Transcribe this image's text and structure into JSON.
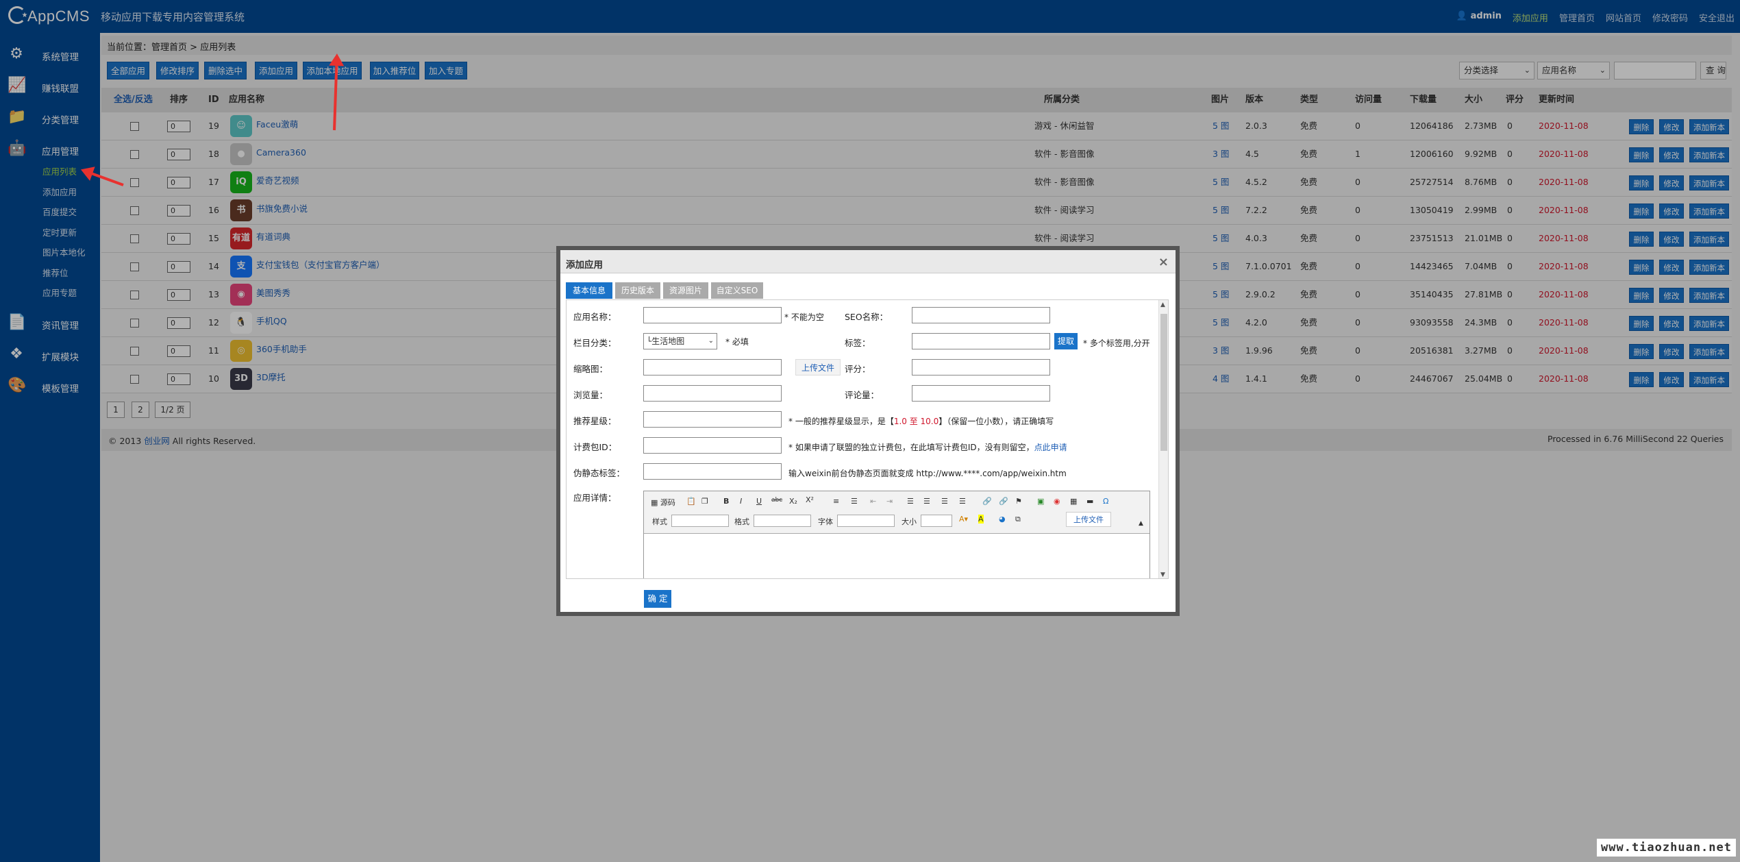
{
  "app": {
    "logo": "AppCMS",
    "tagline": "移动应用下载专用内容管理系统"
  },
  "toplinks": {
    "user": "admin",
    "add": "添加应用",
    "home": "管理首页",
    "site": "网站首页",
    "pwd": "修改密码",
    "logout": "安全退出"
  },
  "sidebar": {
    "groups": [
      "系统管理",
      "赚钱联盟",
      "分类管理",
      "应用管理",
      "资讯管理",
      "扩展模块",
      "模板管理"
    ],
    "subs": [
      "应用列表",
      "添加应用",
      "百度提交",
      "定时更新",
      "图片本地化",
      "推荐位",
      "应用专题"
    ]
  },
  "breadcrumb": {
    "prefix": "当前位置：",
    "home": "管理首页",
    "sep": ">",
    "current": "应用列表"
  },
  "toolbar": {
    "b1": "全部应用",
    "b2": "修改排序",
    "b3": "删除选中",
    "b4": "添加应用",
    "b5": "添加本地应用",
    "b6": "加入推荐位",
    "b7": "加入专题",
    "sel1": "分类选择",
    "sel2": "应用名称",
    "search": "查 询"
  },
  "table": {
    "headers": [
      "全选/反选",
      "排序",
      "ID",
      "应用名称",
      "所属分类",
      "图片",
      "版本",
      "类型",
      "访问量",
      "下载量",
      "大小",
      "评分",
      "更新时间"
    ],
    "rows": [
      {
        "order": "0",
        "id": "19",
        "name": "Faceu激萌",
        "cat": "游戏 - 休闲益智",
        "pic": "5 图",
        "ver": "2.0.3",
        "type": "免费",
        "visits": "0",
        "dl": "12064186",
        "size": "2.73MB",
        "score": "0",
        "date": "2020-11-08",
        "ic": "#5ec7c7",
        "it": "☺"
      },
      {
        "order": "0",
        "id": "18",
        "name": "Camera360",
        "cat": "软件 - 影音图像",
        "pic": "3 图",
        "ver": "4.5",
        "type": "免费",
        "visits": "1",
        "dl": "12006160",
        "size": "9.92MB",
        "score": "0",
        "date": "2020-11-08",
        "ic": "#c8c8c8",
        "it": "●"
      },
      {
        "order": "0",
        "id": "17",
        "name": "爱奇艺视频",
        "cat": "软件 - 影音图像",
        "pic": "5 图",
        "ver": "4.5.2",
        "type": "免费",
        "visits": "0",
        "dl": "25727514",
        "size": "8.76MB",
        "score": "0",
        "date": "2020-11-08",
        "ic": "#17b61c",
        "it": "iQ"
      },
      {
        "order": "0",
        "id": "16",
        "name": "书旗免费小说",
        "cat": "软件 - 阅读学习",
        "pic": "5 图",
        "ver": "7.2.2",
        "type": "免费",
        "visits": "0",
        "dl": "13050419",
        "size": "2.99MB",
        "score": "0",
        "date": "2020-11-08",
        "ic": "#6b3d2a",
        "it": "书"
      },
      {
        "order": "0",
        "id": "15",
        "name": "有道词典",
        "cat": "软件 - 阅读学习",
        "pic": "5 图",
        "ver": "4.0.3",
        "type": "免费",
        "visits": "0",
        "dl": "23751513",
        "size": "21.01MB",
        "score": "0",
        "date": "2020-11-08",
        "ic": "#d8272c",
        "it": "有道"
      },
      {
        "order": "0",
        "id": "14",
        "name": "支付宝钱包（支付宝官方客户端）",
        "cat": "",
        "pic": "5 图",
        "ver": "7.1.0.0701",
        "type": "免费",
        "visits": "0",
        "dl": "14423465",
        "size": "7.04MB",
        "score": "0",
        "date": "2020-11-08",
        "ic": "#1677ff",
        "it": "支"
      },
      {
        "order": "0",
        "id": "13",
        "name": "美图秀秀",
        "cat": "",
        "pic": "5 图",
        "ver": "2.9.0.2",
        "type": "免费",
        "visits": "0",
        "dl": "35140435",
        "size": "27.81MB",
        "score": "0",
        "date": "2020-11-08",
        "ic": "#e8447c",
        "it": "◉"
      },
      {
        "order": "0",
        "id": "12",
        "name": "手机QQ",
        "cat": "",
        "pic": "5 图",
        "ver": "4.2.0",
        "type": "免费",
        "visits": "0",
        "dl": "93093558",
        "size": "24.3MB",
        "score": "0",
        "date": "2020-11-08",
        "ic": "#ffffff",
        "it": "🐧"
      },
      {
        "order": "0",
        "id": "11",
        "name": "360手机助手",
        "cat": "",
        "pic": "3 图",
        "ver": "1.9.96",
        "type": "免费",
        "visits": "0",
        "dl": "20516381",
        "size": "3.27MB",
        "score": "0",
        "date": "2020-11-08",
        "ic": "#f0c030",
        "it": "◎"
      },
      {
        "order": "0",
        "id": "10",
        "name": "3D摩托",
        "cat": "",
        "pic": "4 图",
        "ver": "1.4.1",
        "type": "免费",
        "visits": "0",
        "dl": "24467067",
        "size": "25.04MB",
        "score": "0",
        "date": "2020-11-08",
        "ic": "#3a3a4a",
        "it": "3D"
      }
    ],
    "actions": [
      "删除",
      "修改",
      "添加新本"
    ]
  },
  "pager": {
    "p1": "1",
    "p2": "2",
    "info": "1/2 页"
  },
  "footer": {
    "copy": "© 2013",
    "brand": "创业网",
    "rights": "All rights Reserved.",
    "perf": "Processed in 6.76 MilliSecond 22 Queries"
  },
  "dialog": {
    "title": "添加应用",
    "close": "×",
    "tabs": [
      "基本信息",
      "历史版本",
      "资源图片",
      "自定义SEO"
    ],
    "labels": {
      "name": "应用名称：",
      "cat": "栏目分类：",
      "thumb": "缩略图：",
      "views": "浏览量：",
      "stars": "推荐星级：",
      "pkg": "计费包ID：",
      "static": "伪静态标签：",
      "detail": "应用详情：",
      "seo": "SEO名称：",
      "tags": "标签：",
      "score": "评分：",
      "comments": "评论量："
    },
    "notes": {
      "notempty": "* 不能为空",
      "req": "* 必填",
      "tags": "* 多个标签用,分开",
      "stars_a": "* 一般的推荐星级显示，是【",
      "stars_range": "1.0 至 10.0",
      "stars_b": "】（保留一位小数），请正确填写",
      "pkg_a": "* 如果申请了联盟的独立计费包，在此填写计费包ID，没有则留空，",
      "pkg_link": "点此申请",
      "static": "输入weixin前台伪静态页面就变成 http://www.****.com/app/weixin.htm"
    },
    "catsel": "└生活地图",
    "extract": "提取",
    "upload": "上传文件",
    "editor": {
      "source": "源码",
      "style": "样式",
      "format": "格式",
      "font": "字体",
      "size": "大小",
      "upload": "上传文件"
    },
    "ok": "确 定"
  },
  "watermark": "www.tiaozhuan.net"
}
